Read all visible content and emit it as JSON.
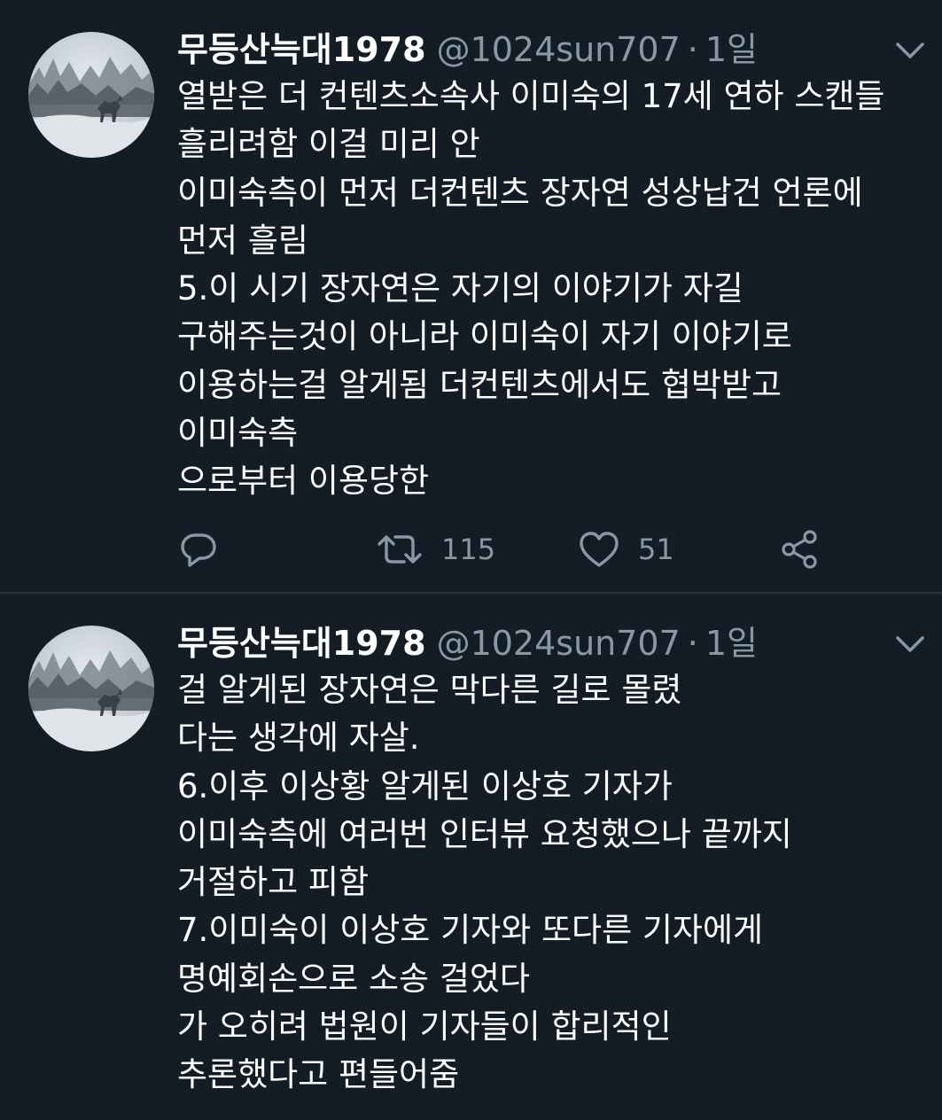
{
  "tweets": [
    {
      "author": {
        "display_name": "무등산늑대1978",
        "handle": "@1024sun707",
        "separator": "·",
        "time": "1일"
      },
      "lines": [
        "열받은 더 컨텐츠소속사 이미숙의 17세 연하 스캔들",
        "흘리려함 이걸 미리 안",
        "이미숙측이 먼저 더컨텐츠 장자연 성상납건 언론에",
        "먼저 흘림",
        "5.이 시기 장자연은 자기의 이야기가 자길",
        "구해주는것이 아니라 이미숙이 자기 이야기로",
        "이용하는걸 알게됨 더컨텐츠에서도 협박받고",
        "이미숙측",
        "으로부터 이용당한"
      ],
      "actions": {
        "retweet_count": "115",
        "like_count": "51"
      }
    },
    {
      "author": {
        "display_name": "무등산늑대1978",
        "handle": "@1024sun707",
        "separator": "·",
        "time": "1일"
      },
      "lines": [
        "걸 알게된 장자연은 막다른 길로 몰렸",
        "다는 생각에 자살.",
        "6.이후 이상황 알게된 이상호 기자가",
        "이미숙측에 여러번 인터뷰 요청했으나 끝까지",
        "거절하고 피함",
        "7.이미숙이 이상호 기자와 또다른 기자에게",
        "명예회손으로 소송 걸었다",
        "가 오히려 법원이 기자들이 합리적인",
        "추론했다고 편들어줌"
      ]
    }
  ],
  "theme": {
    "background": "#141d26",
    "text": "#ffffff",
    "secondary_text": "#8899a6",
    "divider": "#263340"
  },
  "icons": {
    "reply": "reply-icon",
    "retweet": "retweet-icon",
    "like": "heart-icon",
    "share": "share-icon",
    "menu": "chevron-down-icon"
  }
}
